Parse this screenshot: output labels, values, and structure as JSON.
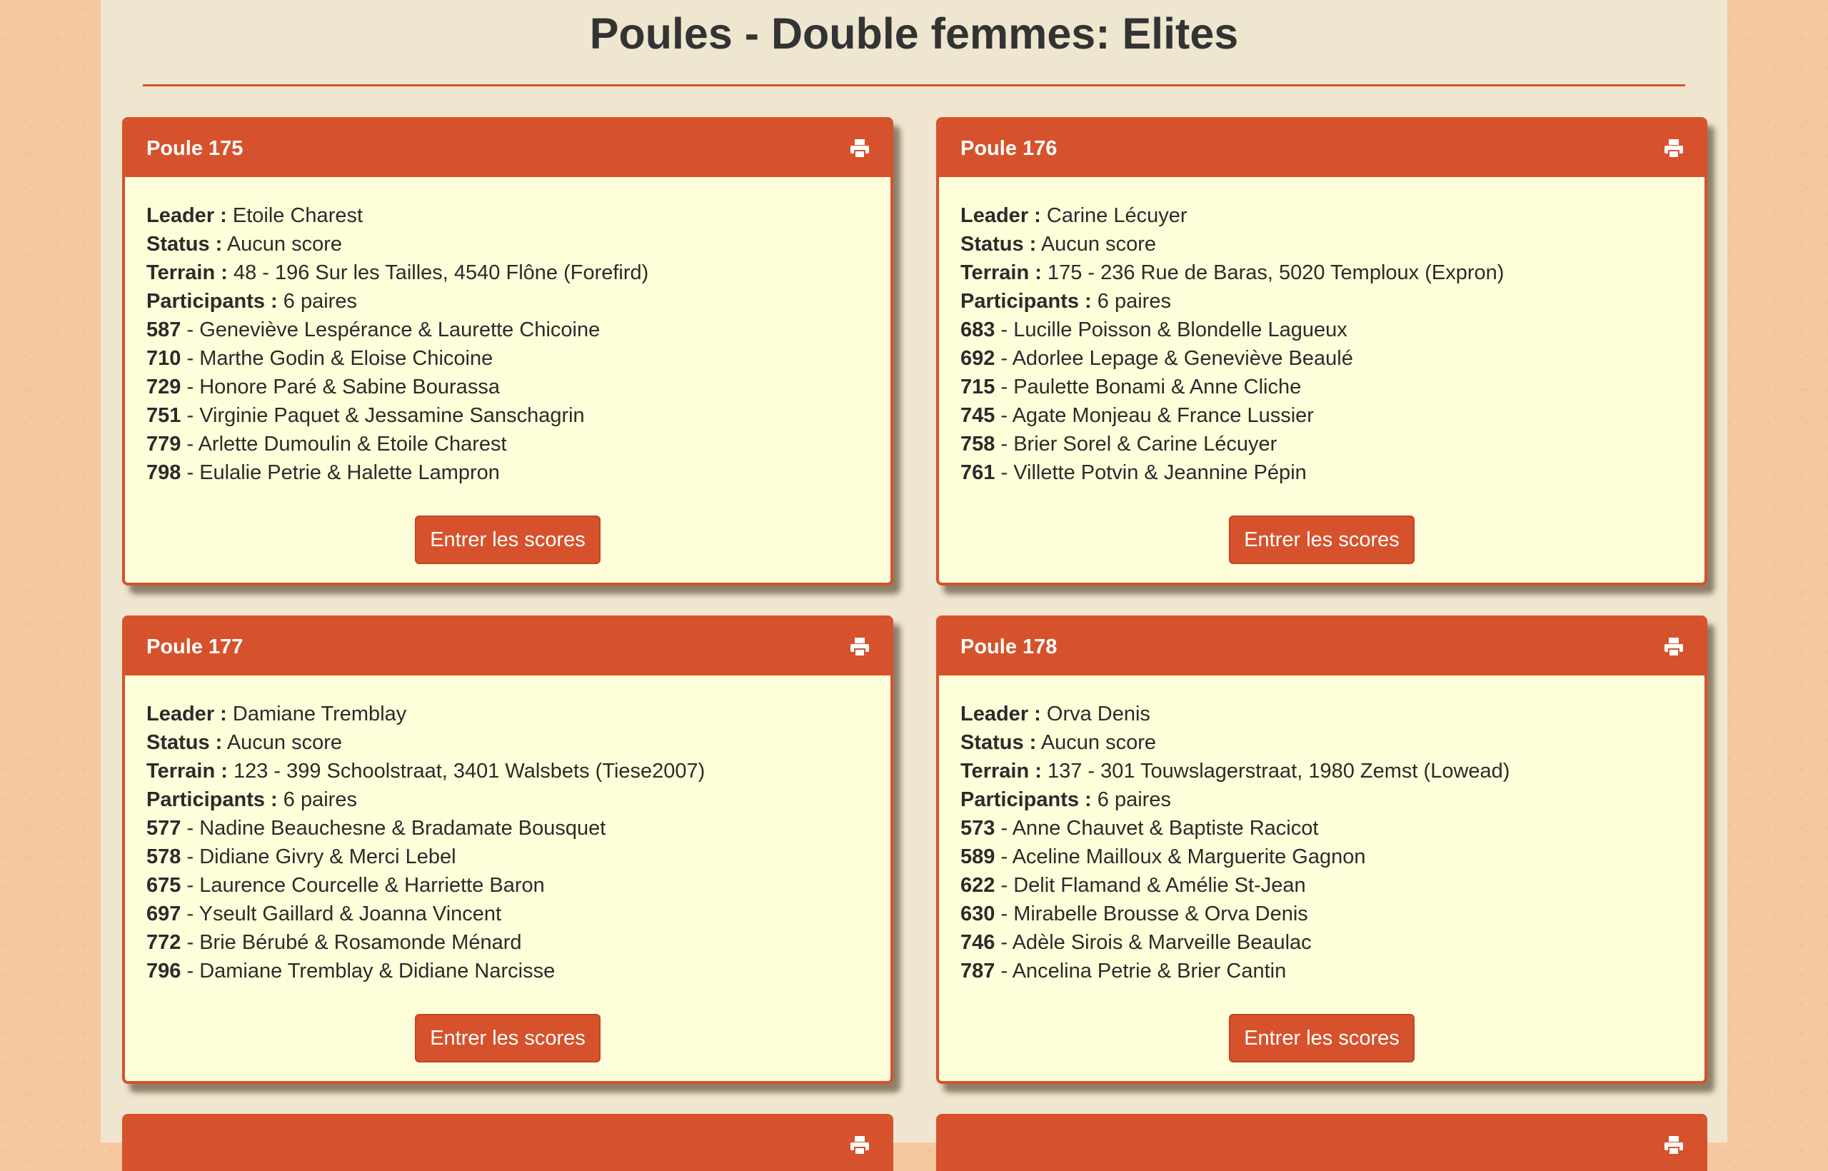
{
  "page": {
    "title": "Poules - Double femmes: Elites"
  },
  "labels": {
    "leader": "Leader :",
    "status": "Status :",
    "terrain": "Terrain :",
    "participants": "Participants :",
    "enter_scores": "Entrer les scores",
    "sep": "-"
  },
  "colors": {
    "accent": "#d6522c",
    "panel_bg": "#fffedb",
    "page_bg": "#efe6cf",
    "outer_bg": "#f6c8a0"
  },
  "icons": {
    "print": "print-icon"
  },
  "poules": [
    {
      "title": "Poule 175",
      "leader": "Etoile Charest",
      "status": "Aucun score",
      "terrain": "48 - 196 Sur les Tailles, 4540 Flône (Forefird)",
      "participants": "6 paires",
      "pairs": [
        {
          "num": "587",
          "names": "Geneviève Lespérance & Laurette Chicoine"
        },
        {
          "num": "710",
          "names": "Marthe Godin & Eloise Chicoine"
        },
        {
          "num": "729",
          "names": "Honore Paré & Sabine Bourassa"
        },
        {
          "num": "751",
          "names": "Virginie Paquet & Jessamine Sanschagrin"
        },
        {
          "num": "779",
          "names": "Arlette Dumoulin & Etoile Charest"
        },
        {
          "num": "798",
          "names": "Eulalie Petrie & Halette Lampron"
        }
      ]
    },
    {
      "title": "Poule 176",
      "leader": "Carine Lécuyer",
      "status": "Aucun score",
      "terrain": "175 - 236 Rue de Baras, 5020 Temploux (Expron)",
      "participants": "6 paires",
      "pairs": [
        {
          "num": "683",
          "names": "Lucille Poisson & Blondelle Lagueux"
        },
        {
          "num": "692",
          "names": "Adorlee Lepage & Geneviève Beaulé"
        },
        {
          "num": "715",
          "names": "Paulette Bonami & Anne Cliche"
        },
        {
          "num": "745",
          "names": "Agate Monjeau & France Lussier"
        },
        {
          "num": "758",
          "names": "Brier Sorel & Carine Lécuyer"
        },
        {
          "num": "761",
          "names": "Villette Potvin & Jeannine Pépin"
        }
      ]
    },
    {
      "title": "Poule 177",
      "leader": "Damiane Tremblay",
      "status": "Aucun score",
      "terrain": "123 - 399 Schoolstraat, 3401 Walsbets (Tiese2007)",
      "participants": "6 paires",
      "pairs": [
        {
          "num": "577",
          "names": "Nadine Beauchesne & Bradamate Bousquet"
        },
        {
          "num": "578",
          "names": "Didiane Givry & Merci Lebel"
        },
        {
          "num": "675",
          "names": "Laurence Courcelle & Harriette Baron"
        },
        {
          "num": "697",
          "names": "Yseult Gaillard & Joanna Vincent"
        },
        {
          "num": "772",
          "names": "Brie Bérubé & Rosamonde Ménard"
        },
        {
          "num": "796",
          "names": "Damiane Tremblay & Didiane Narcisse"
        }
      ]
    },
    {
      "title": "Poule 178",
      "leader": "Orva Denis",
      "status": "Aucun score",
      "terrain": "137 - 301 Touwslagerstraat, 1980 Zemst (Lowead)",
      "participants": "6 paires",
      "pairs": [
        {
          "num": "573",
          "names": "Anne Chauvet & Baptiste Racicot"
        },
        {
          "num": "589",
          "names": "Aceline Mailloux & Marguerite Gagnon"
        },
        {
          "num": "622",
          "names": "Delit Flamand & Amélie St-Jean"
        },
        {
          "num": "630",
          "names": "Mirabelle Brousse & Orva Denis"
        },
        {
          "num": "746",
          "names": "Adèle Sirois & Marveille Beaulac"
        },
        {
          "num": "787",
          "names": "Ancelina Petrie & Brier Cantin"
        }
      ]
    }
  ]
}
